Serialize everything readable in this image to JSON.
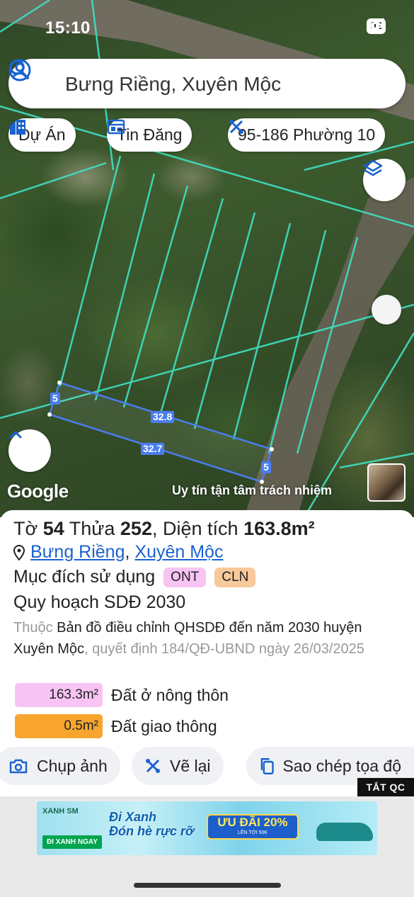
{
  "status_bar": {
    "time": "15:10",
    "battery": "92"
  },
  "search": {
    "query": "Bưng Riềng, Xuyên Mộc"
  },
  "chips": [
    {
      "label": "Dự Án",
      "icon": "building-icon"
    },
    {
      "label": "Tin Đăng",
      "icon": "listing-icon"
    },
    {
      "label": "95-186 Phường 10",
      "icon": "tools-icon"
    }
  ],
  "map": {
    "dimensions": {
      "top": "32.8",
      "bottom": "32.7",
      "left": "5",
      "right": "5"
    },
    "logo": "Google",
    "watermark": "Uy tín tận tâm trách nhiệm",
    "colors": {
      "parcel_lines": "#3fe0c2",
      "selection": "#4a7df0"
    }
  },
  "parcel": {
    "sheet_label": "Tờ",
    "sheet": "54",
    "lot_label": "Thửa",
    "lot": "252",
    "area_label": "Diện tích",
    "area": "163.8m²",
    "ward": "Bưng Riềng",
    "district": "Xuyên Mộc",
    "purpose_label": "Mục đích sử dụng",
    "purpose_tags": [
      {
        "code": "ONT",
        "color": "#f8c4f4"
      },
      {
        "code": "CLN",
        "color": "#f8c99a"
      }
    ],
    "plan_title": "Quy hoạch SDĐ 2030",
    "plan_prefix": "Thuộc",
    "plan_name": "Bản đồ điều chỉnh QHSDĐ đến năm 2030 huyện Xuyên Mộc",
    "plan_decision": ", quyết định 184/QĐ-UBND ngày 26/03/2025",
    "land_uses": [
      {
        "area": "163.3m²",
        "label": "Đất ở nông thôn",
        "color": "#f8c4f4"
      },
      {
        "area": "0.5m²",
        "label": "Đất giao thông",
        "color": "#f7a52f"
      }
    ]
  },
  "actions": [
    {
      "label": "Chụp ảnh",
      "icon": "camera-icon"
    },
    {
      "label": "Vẽ lại",
      "icon": "redraw-icon"
    },
    {
      "label": "Sao chép tọa độ",
      "icon": "copy-icon"
    }
  ],
  "ad": {
    "close_label": "TẮT QC",
    "brand": "XANH SM",
    "cta": "ĐI XANH NGAY",
    "headline_1": "Đi Xanh",
    "headline_2": "Đón hè rực rỡ",
    "promo": "ƯU ĐÃI 20%",
    "promo_sub": "LÊN TỚI 50K"
  }
}
